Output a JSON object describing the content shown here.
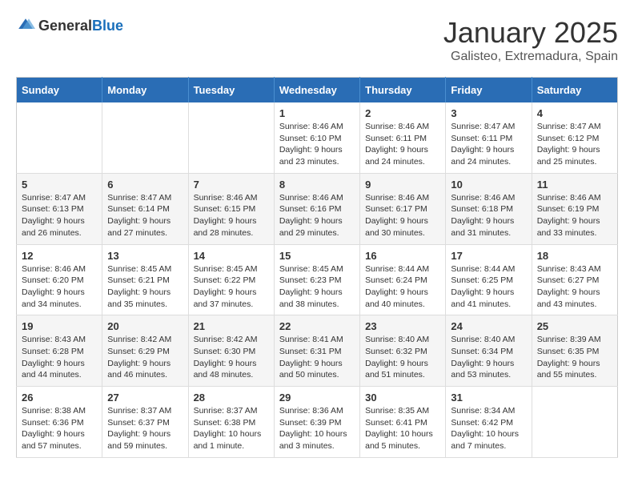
{
  "logo": {
    "text1": "General",
    "text2": "Blue"
  },
  "title": "January 2025",
  "subtitle": "Galisteo, Extremadura, Spain",
  "weekdays": [
    "Sunday",
    "Monday",
    "Tuesday",
    "Wednesday",
    "Thursday",
    "Friday",
    "Saturday"
  ],
  "weeks": [
    [
      {
        "day": "",
        "info": ""
      },
      {
        "day": "",
        "info": ""
      },
      {
        "day": "",
        "info": ""
      },
      {
        "day": "1",
        "info": "Sunrise: 8:46 AM\nSunset: 6:10 PM\nDaylight: 9 hours and 23 minutes."
      },
      {
        "day": "2",
        "info": "Sunrise: 8:46 AM\nSunset: 6:11 PM\nDaylight: 9 hours and 24 minutes."
      },
      {
        "day": "3",
        "info": "Sunrise: 8:47 AM\nSunset: 6:11 PM\nDaylight: 9 hours and 24 minutes."
      },
      {
        "day": "4",
        "info": "Sunrise: 8:47 AM\nSunset: 6:12 PM\nDaylight: 9 hours and 25 minutes."
      }
    ],
    [
      {
        "day": "5",
        "info": "Sunrise: 8:47 AM\nSunset: 6:13 PM\nDaylight: 9 hours and 26 minutes."
      },
      {
        "day": "6",
        "info": "Sunrise: 8:47 AM\nSunset: 6:14 PM\nDaylight: 9 hours and 27 minutes."
      },
      {
        "day": "7",
        "info": "Sunrise: 8:46 AM\nSunset: 6:15 PM\nDaylight: 9 hours and 28 minutes."
      },
      {
        "day": "8",
        "info": "Sunrise: 8:46 AM\nSunset: 6:16 PM\nDaylight: 9 hours and 29 minutes."
      },
      {
        "day": "9",
        "info": "Sunrise: 8:46 AM\nSunset: 6:17 PM\nDaylight: 9 hours and 30 minutes."
      },
      {
        "day": "10",
        "info": "Sunrise: 8:46 AM\nSunset: 6:18 PM\nDaylight: 9 hours and 31 minutes."
      },
      {
        "day": "11",
        "info": "Sunrise: 8:46 AM\nSunset: 6:19 PM\nDaylight: 9 hours and 33 minutes."
      }
    ],
    [
      {
        "day": "12",
        "info": "Sunrise: 8:46 AM\nSunset: 6:20 PM\nDaylight: 9 hours and 34 minutes."
      },
      {
        "day": "13",
        "info": "Sunrise: 8:45 AM\nSunset: 6:21 PM\nDaylight: 9 hours and 35 minutes."
      },
      {
        "day": "14",
        "info": "Sunrise: 8:45 AM\nSunset: 6:22 PM\nDaylight: 9 hours and 37 minutes."
      },
      {
        "day": "15",
        "info": "Sunrise: 8:45 AM\nSunset: 6:23 PM\nDaylight: 9 hours and 38 minutes."
      },
      {
        "day": "16",
        "info": "Sunrise: 8:44 AM\nSunset: 6:24 PM\nDaylight: 9 hours and 40 minutes."
      },
      {
        "day": "17",
        "info": "Sunrise: 8:44 AM\nSunset: 6:25 PM\nDaylight: 9 hours and 41 minutes."
      },
      {
        "day": "18",
        "info": "Sunrise: 8:43 AM\nSunset: 6:27 PM\nDaylight: 9 hours and 43 minutes."
      }
    ],
    [
      {
        "day": "19",
        "info": "Sunrise: 8:43 AM\nSunset: 6:28 PM\nDaylight: 9 hours and 44 minutes."
      },
      {
        "day": "20",
        "info": "Sunrise: 8:42 AM\nSunset: 6:29 PM\nDaylight: 9 hours and 46 minutes."
      },
      {
        "day": "21",
        "info": "Sunrise: 8:42 AM\nSunset: 6:30 PM\nDaylight: 9 hours and 48 minutes."
      },
      {
        "day": "22",
        "info": "Sunrise: 8:41 AM\nSunset: 6:31 PM\nDaylight: 9 hours and 50 minutes."
      },
      {
        "day": "23",
        "info": "Sunrise: 8:40 AM\nSunset: 6:32 PM\nDaylight: 9 hours and 51 minutes."
      },
      {
        "day": "24",
        "info": "Sunrise: 8:40 AM\nSunset: 6:34 PM\nDaylight: 9 hours and 53 minutes."
      },
      {
        "day": "25",
        "info": "Sunrise: 8:39 AM\nSunset: 6:35 PM\nDaylight: 9 hours and 55 minutes."
      }
    ],
    [
      {
        "day": "26",
        "info": "Sunrise: 8:38 AM\nSunset: 6:36 PM\nDaylight: 9 hours and 57 minutes."
      },
      {
        "day": "27",
        "info": "Sunrise: 8:37 AM\nSunset: 6:37 PM\nDaylight: 9 hours and 59 minutes."
      },
      {
        "day": "28",
        "info": "Sunrise: 8:37 AM\nSunset: 6:38 PM\nDaylight: 10 hours and 1 minute."
      },
      {
        "day": "29",
        "info": "Sunrise: 8:36 AM\nSunset: 6:39 PM\nDaylight: 10 hours and 3 minutes."
      },
      {
        "day": "30",
        "info": "Sunrise: 8:35 AM\nSunset: 6:41 PM\nDaylight: 10 hours and 5 minutes."
      },
      {
        "day": "31",
        "info": "Sunrise: 8:34 AM\nSunset: 6:42 PM\nDaylight: 10 hours and 7 minutes."
      },
      {
        "day": "",
        "info": ""
      }
    ]
  ]
}
